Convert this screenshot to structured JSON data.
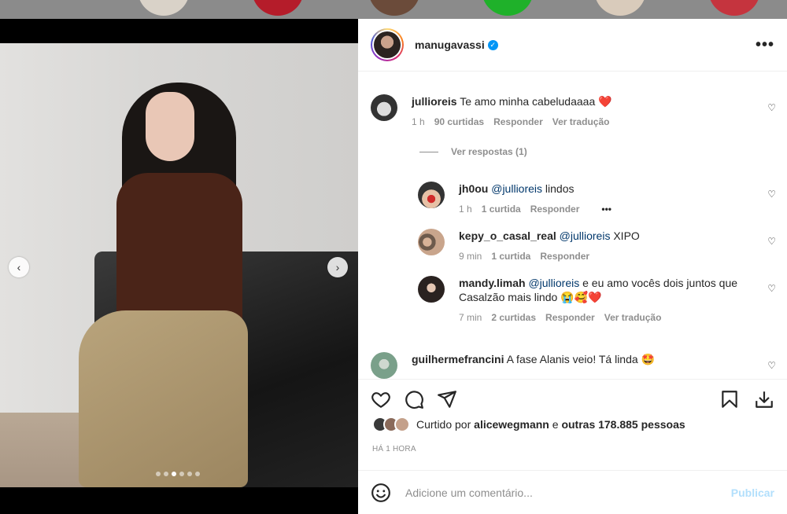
{
  "post": {
    "username": "manugavassi",
    "more_label": "•••"
  },
  "comments": [
    {
      "user": "jullioreis",
      "text": "Te amo minha cabeludaaaa ❤️",
      "time": "1 h",
      "likes": "90 curtidas",
      "reply": "Responder",
      "translate": "Ver tradução"
    },
    {
      "user": "jh0ou",
      "mention": "@jullioreis",
      "text": " lindos",
      "time": "1 h",
      "likes": "1 curtida",
      "reply": "Responder",
      "more": "•••"
    },
    {
      "user": "kepy_o_casal_real",
      "mention": "@jullioreis",
      "text": " XIPO",
      "time": "9 min",
      "likes": "1 curtida",
      "reply": "Responder"
    },
    {
      "user": "mandy.limah",
      "mention": "@jullioreis",
      "text": " e eu amo vocês dois juntos que Casalzão mais lindo 😭🥰❤️",
      "time": "7 min",
      "likes": "2 curtidas",
      "reply": "Responder",
      "translate": "Ver tradução"
    },
    {
      "user": "guilhermefrancini",
      "text": "A fase Alanis veio! Tá linda 🤩"
    }
  ],
  "view_replies": "Ver respostas (1)",
  "likes": {
    "prefix": "Curtido por",
    "user": "alicewegmann",
    "mid": "e",
    "others": "outras 178.885 pessoas"
  },
  "time_ago": "HÁ 1 HORA",
  "add_comment": {
    "placeholder": "Adicione um comentário...",
    "publish": "Publicar"
  },
  "colors": {
    "accent": "#0095f6",
    "heart": "#ed4956",
    "publish_disabled": "#b2dffc"
  }
}
